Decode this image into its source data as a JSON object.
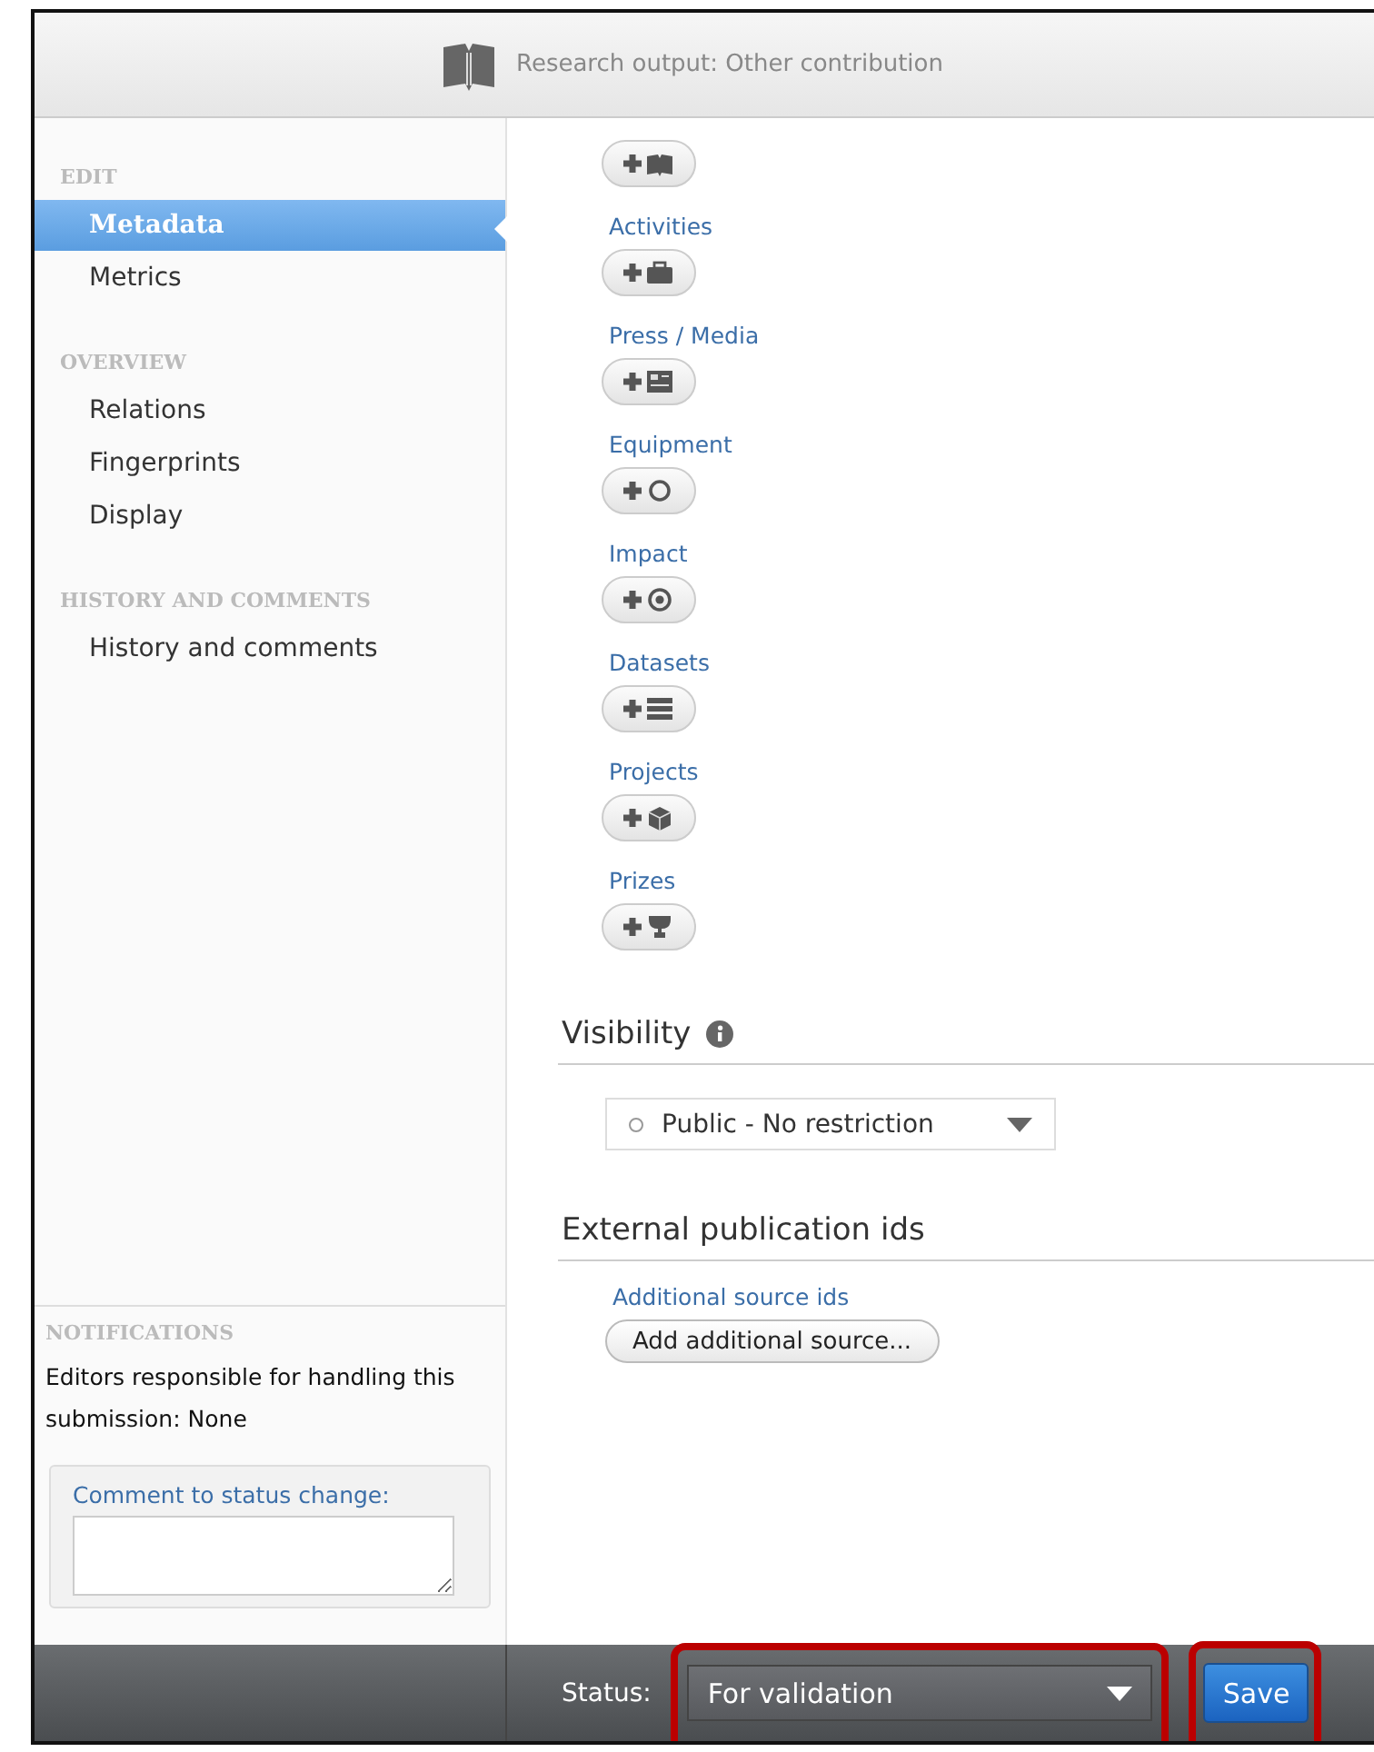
{
  "window": {
    "title": "Research output: Other contribution"
  },
  "sidebar": {
    "sections": [
      {
        "heading": "EDIT",
        "items": [
          {
            "label": "Metadata",
            "selected": true
          },
          {
            "label": "Metrics",
            "selected": false
          }
        ]
      },
      {
        "heading": "OVERVIEW",
        "items": [
          {
            "label": "Relations",
            "selected": false
          },
          {
            "label": "Fingerprints",
            "selected": false
          },
          {
            "label": "Display",
            "selected": false
          }
        ]
      },
      {
        "heading": "HISTORY AND COMMENTS",
        "items": [
          {
            "label": "History and comments",
            "selected": false
          }
        ]
      }
    ],
    "notifications": {
      "heading": "NOTIFICATIONS",
      "text": "Editors responsible for handling this submission: None"
    },
    "comment": {
      "label": "Comment to status change:"
    }
  },
  "relations": [
    {
      "kind": "book"
    },
    {
      "label": "Activities",
      "kind": "briefcase"
    },
    {
      "label": "Press / Media",
      "kind": "newspaper"
    },
    {
      "label": "Equipment",
      "kind": "ring"
    },
    {
      "label": "Impact",
      "kind": "target"
    },
    {
      "label": "Datasets",
      "kind": "stack"
    },
    {
      "label": "Projects",
      "kind": "cube"
    },
    {
      "label": "Prizes",
      "kind": "trophy"
    }
  ],
  "visibility": {
    "heading": "Visibility",
    "value": "Public - No restriction"
  },
  "external_ids": {
    "heading": "External publication ids",
    "label": "Additional source ids",
    "button": "Add additional source..."
  },
  "status_bar": {
    "label": "Status:",
    "value": "For validation",
    "value_highlighted": true,
    "save": "Save",
    "save_highlighted": true
  }
}
